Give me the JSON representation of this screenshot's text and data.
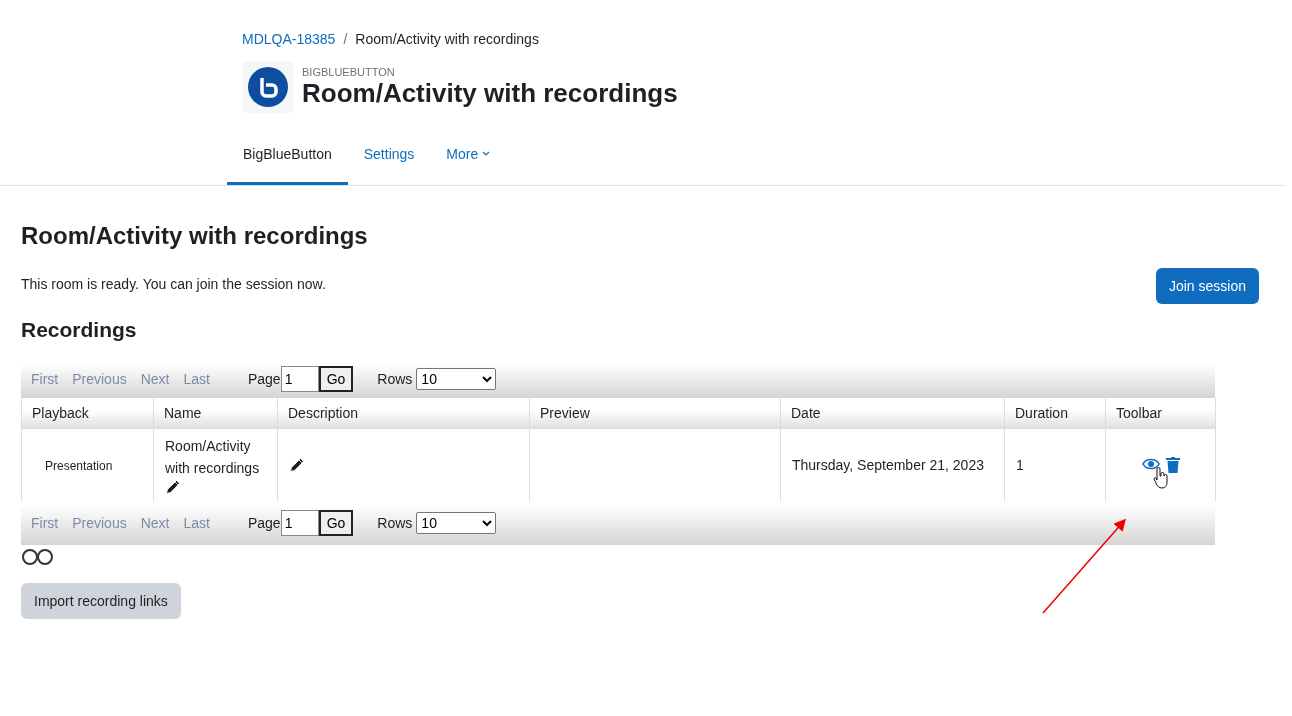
{
  "breadcrumb": [
    {
      "label": "MDLQA-18385",
      "link": true
    },
    {
      "label": "Room/Activity with recordings",
      "link": false
    }
  ],
  "breadcrumb_separator": "/",
  "header": {
    "module": "BIGBLUEBUTTON",
    "title": "Room/Activity with recordings"
  },
  "tabs": [
    {
      "label": "BigBlueButton",
      "selected": true,
      "dropdown": false
    },
    {
      "label": "Settings",
      "selected": false,
      "dropdown": false
    },
    {
      "label": "More",
      "selected": false,
      "dropdown": true
    }
  ],
  "page_title": "Room/Activity with recordings",
  "notice": "This room is ready. You can join the session now.",
  "join_button": "Join session",
  "recordings_heading": "Recordings",
  "pagers": [
    {
      "links": [
        {
          "label": "First",
          "disabled": true
        },
        {
          "label": "Previous",
          "disabled": true
        },
        {
          "label": "Next",
          "disabled": true
        },
        {
          "label": "Last",
          "disabled": true
        }
      ],
      "page_label": "Page",
      "page_value": "1",
      "go": "Go",
      "rows_label": "Rows",
      "rows_value": "10"
    },
    {
      "links": [
        {
          "label": "First",
          "disabled": true
        },
        {
          "label": "Previous",
          "disabled": true
        },
        {
          "label": "Next",
          "disabled": true
        },
        {
          "label": "Last",
          "disabled": true
        }
      ],
      "page_label": "Page",
      "page_value": "1",
      "go": "Go",
      "rows_label": "Rows",
      "rows_value": "10"
    }
  ],
  "table": {
    "columns": [
      "Playback",
      "Name",
      "Description",
      "Preview",
      "Date",
      "Duration",
      "Toolbar"
    ],
    "rows": [
      {
        "playback": "Presentation",
        "name": "Room/Activity with recordings",
        "date": "Thursday, September 21, 2023",
        "duration": "1"
      }
    ]
  },
  "import_button": "Import recording links"
}
